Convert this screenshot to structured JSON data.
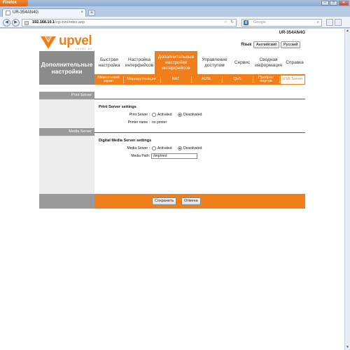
{
  "browser": {
    "menu_label": "Firefox",
    "tab_title": "UR-354AN4G",
    "url_host": "192.168.10.1",
    "url_path": "/cgi-bin/index.asp",
    "search_placeholder": "Google"
  },
  "header": {
    "model": "UR-354AN4G",
    "logo_text": "upvel",
    "logo_subtext": "LEVEL UP",
    "language_label": "Язык",
    "lang_english": "Английский",
    "lang_russian": "Русский"
  },
  "section_title": "Дополнительные настройки",
  "nav": [
    {
      "label": "Быстрая настройка"
    },
    {
      "label": "Настройка интерфейсов"
    },
    {
      "label": "Дополнительные настройки интерфейсов"
    },
    {
      "label": "Управление доступом"
    },
    {
      "label": "Сервис"
    },
    {
      "label": "Сводная информация"
    },
    {
      "label": "Справка"
    }
  ],
  "subnav": [
    {
      "label": "Межсетевой экран"
    },
    {
      "label": "Маршрутизация"
    },
    {
      "label": "NAT"
    },
    {
      "label": "ADSL"
    },
    {
      "label": "QoS"
    },
    {
      "label": "Проброс портов"
    },
    {
      "label": "USB Server"
    }
  ],
  "print_server": {
    "side_label": "Print Server",
    "title": "Print Server settings",
    "field_label": "Print Server :",
    "option_activated": "Activated",
    "option_deactivated": "Deactivated",
    "selected": "Deactivated",
    "printer_name_label": "Printer name :",
    "printer_name_value": "no printer"
  },
  "media_server": {
    "side_label": "Media Server",
    "title": "Digital Media Server settings",
    "field_label": "Media Server :",
    "option_activated": "Activated",
    "option_deactivated": "Deactivated",
    "selected": "Deactivated",
    "path_label": "Media Path:",
    "path_value": "/tmp/mnt"
  },
  "footer": {
    "save_label": "Сохранить",
    "cancel_label": "Отмена"
  },
  "colors": {
    "accent": "#f07e1a",
    "side_gray": "#9a9a9a"
  }
}
